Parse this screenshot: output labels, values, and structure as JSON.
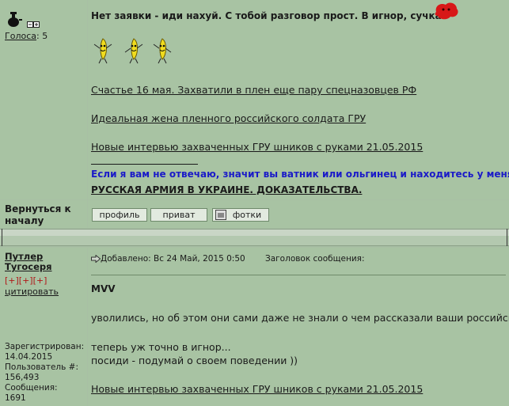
{
  "post1": {
    "votes_label": "Голоса",
    "votes_count": ": 5",
    "title": "Нет заявки - иди нахуй. С тобой разговор прост. В игнор, сучка",
    "links": [
      "Счастье 16 мая. Захватили в плен еще пару спецназовцев РФ",
      "Идеальная жена пленного российского солдата ГРУ",
      "Новые интервью захваченных ГРУ шников с руками 21.05.2015"
    ],
    "sig_line": "Если я вам не отвечаю, значит вы ватник или ольгинец и находитесь у меня",
    "sig_link": "РУССКАЯ АРМИЯ В УКРАИНЕ. ДОКАЗАТЕЛЬСТВА.",
    "back_to_top": "Вернуться к началу",
    "buttons": {
      "profile": "профиль",
      "private": "приват",
      "photos": "фотки"
    }
  },
  "post2": {
    "author": "Путлер Тугосеря",
    "rep": "[+][+][+]",
    "quote_link": "цитировать",
    "posted_label": "Добавлено: Вс 24 Май, 2015 0:50",
    "subject_label": "Заголовок сообщения:",
    "quote_author": "MVV",
    "lines": [
      "уволились, но об этом они сами даже не знали о чем рассказали ваши российски",
      "теперь уж точно в игнор...",
      "посиди - подумай о своем поведении ))"
    ],
    "link": "Новые интервью захваченных ГРУ шников с руками 21.05.2015",
    "registered_label": "Зарегистрирован:",
    "registered_value": "14.04.2015",
    "user_no_label": "Пользователь #:",
    "user_no_value": "156,493",
    "posts_label": "Сообщения:",
    "posts_value": "1691"
  },
  "colors": {
    "bg": "#a8c3a3",
    "sig_blue": "#1a1ac8",
    "rep_red": "#b01818"
  }
}
